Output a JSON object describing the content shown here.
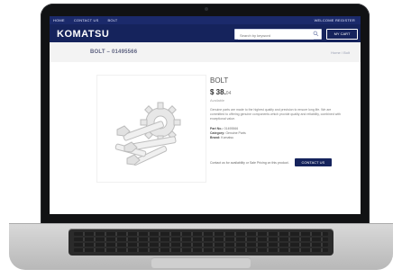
{
  "nav": {
    "items": [
      "HOME",
      "CONTACT US",
      "BOLT"
    ],
    "welcome": "WELCOME REGISTER"
  },
  "header": {
    "logo": "KOMATSU",
    "search_placeholder": "Search by keyword",
    "account_label": "MY CART"
  },
  "page": {
    "title": "BOLT – 01495566",
    "breadcrumb": "Home / Bolt"
  },
  "product": {
    "name": "BOLT",
    "price": "$ 38.",
    "price_currency": "04",
    "stock": "Available",
    "description": "Genuine parts are made to the highest quality and precision to ensure long life. We are committed to offering genuine components which provide quality and reliability, combined with exceptional value.",
    "part_no_label": "Part No.:",
    "part_no": "01495566",
    "category_label": "Category:",
    "category": "Genuine Parts",
    "brand_label": "Brand:",
    "brand": "Komatsu",
    "contact_text": "Contact us for availability or Sale Pricing on this product.",
    "contact_button": "CONTACT US"
  },
  "colors": {
    "brand_navy": "#15235c",
    "topbar_navy": "#1b2a6b"
  }
}
